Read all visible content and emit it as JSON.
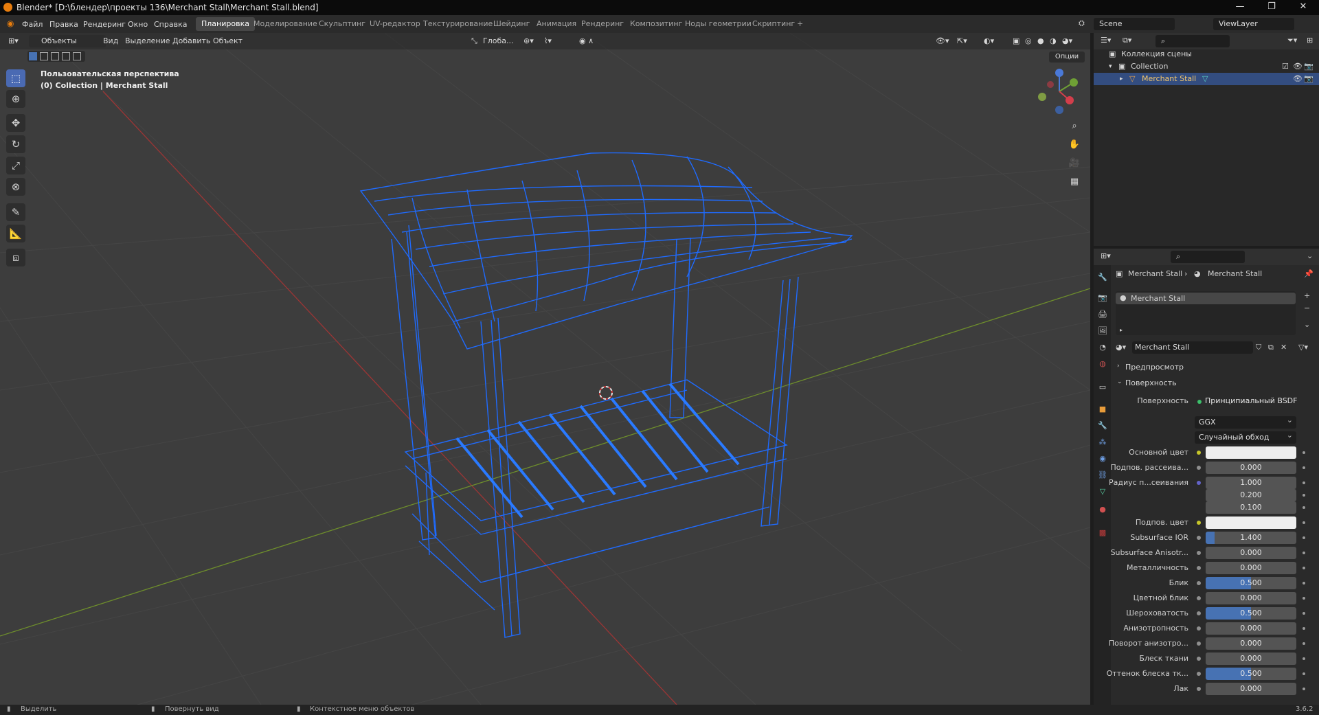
{
  "window": {
    "title": "Blender* [D:\\блендер\\проекты 136\\Merchant Stall\\Merchant Stall.blend]",
    "controls": [
      "—",
      "❐",
      "✕"
    ]
  },
  "menu": [
    "Файл",
    "Правка",
    "Рендеринг",
    "Окно",
    "Справка"
  ],
  "workspaces": [
    "Планировка",
    "Моделирование",
    "Скульптинг",
    "UV-редактор",
    "Текстурирование",
    "Шейдинг",
    "Анимация",
    "Рендеринг",
    "Композитинг",
    "Ноды геометрии",
    "Скриптинг",
    "+"
  ],
  "active_workspace": "Планировка",
  "scene": {
    "label": "Scene",
    "view_layer": "ViewLayer"
  },
  "viewport_header": {
    "mode": "Объекты",
    "menus": [
      "Вид",
      "Выделение",
      "Добавить",
      "Объект"
    ],
    "transform_orientation": "Глоба...",
    "options": "Опции"
  },
  "viewport": {
    "view_name": "Пользовательская перспектива",
    "collection_info": "(0) Collection | Merchant Stall",
    "wire_color": "#1f6bff",
    "grid_color": "#454545"
  },
  "outliner": {
    "scene_collection": "Коллекция сцены",
    "collection": "Collection",
    "object": "Merchant Stall"
  },
  "properties": {
    "breadcrumb": [
      "Merchant Stall",
      "Merchant Stall"
    ],
    "material_slot": "Merchant Stall",
    "material_name": "Merchant Stall",
    "preview_label": "Предпросмотр",
    "surface_section": "Поверхность",
    "surface_label": "Поверхность",
    "surface_value": "Принципиальный BSDF",
    "distribution": "GGX",
    "subsurface_method": "Случайный обход",
    "rows": [
      {
        "label": "Основной цвет",
        "type": "color",
        "value": "#eeeeee",
        "dot": "y"
      },
      {
        "label": "Подпов. рассеива...",
        "type": "number",
        "value": "0.000",
        "fill": 0
      },
      {
        "label": "Радиус п...сеивания",
        "type": "number",
        "value": "1.000",
        "fill": 0,
        "dot": "b"
      },
      {
        "label": "",
        "type": "number",
        "value": "0.200",
        "fill": 0,
        "nodot": true
      },
      {
        "label": "",
        "type": "number",
        "value": "0.100",
        "fill": 0,
        "nodot": true
      },
      {
        "label": "Подпов. цвет",
        "type": "color",
        "value": "#eeeeee",
        "dot": "y"
      },
      {
        "label": "Subsurface IOR",
        "type": "number",
        "value": "1.400",
        "fill": 0.1
      },
      {
        "label": "Subsurface Anisotr...",
        "type": "number",
        "value": "0.000",
        "fill": 0
      },
      {
        "label": "Металличность",
        "type": "number",
        "value": "0.000",
        "fill": 0
      },
      {
        "label": "Блик",
        "type": "number",
        "value": "0.500",
        "fill": 0.5
      },
      {
        "label": "Цветной блик",
        "type": "number",
        "value": "0.000",
        "fill": 0
      },
      {
        "label": "Шероховатость",
        "type": "number",
        "value": "0.500",
        "fill": 0.5
      },
      {
        "label": "Анизотропность",
        "type": "number",
        "value": "0.000",
        "fill": 0
      },
      {
        "label": "Поворот анизотро...",
        "type": "number",
        "value": "0.000",
        "fill": 0
      },
      {
        "label": "Блеск ткани",
        "type": "number",
        "value": "0.000",
        "fill": 0
      },
      {
        "label": "Оттенок блеска тк...",
        "type": "number",
        "value": "0.500",
        "fill": 0.5
      },
      {
        "label": "Лак",
        "type": "number",
        "value": "0.000",
        "fill": 0
      }
    ]
  },
  "statusbar": {
    "select": "Выделить",
    "rotate": "Повернуть вид",
    "context": "Контекстное меню объектов",
    "version": "3.6.2"
  }
}
